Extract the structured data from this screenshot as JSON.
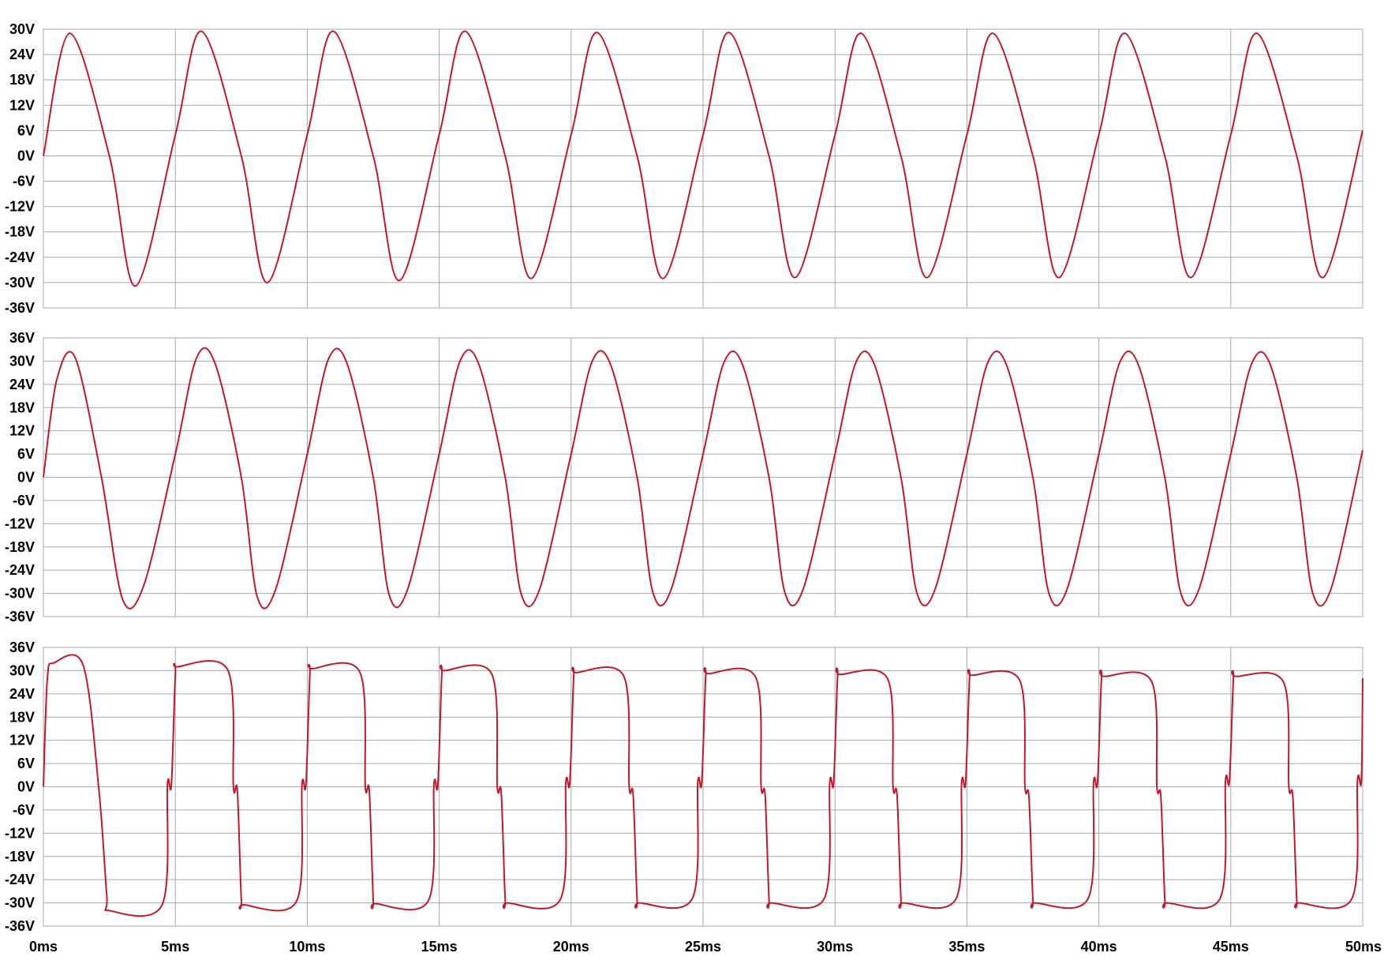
{
  "chart_data": [
    {
      "type": "line",
      "xlim": [
        0,
        50
      ],
      "ylim": [
        -36,
        30
      ],
      "yticks": [
        "30V",
        "24V",
        "18V",
        "12V",
        "6V",
        "0V",
        "-6V",
        "-12V",
        "-18V",
        "-24V",
        "-30V",
        "-36V"
      ],
      "grid": true,
      "series": [
        {
          "color": "#c0182c",
          "x": [
            0,
            1,
            2.5,
            3.5,
            5,
            6,
            7.5,
            8.5,
            10,
            11,
            12.5,
            13.5,
            15,
            16,
            17.5,
            18.5,
            20,
            21,
            22.5,
            23.5,
            25,
            26,
            27.5,
            28.5,
            30,
            31,
            32.5,
            33.5,
            35,
            36,
            37.5,
            38.5,
            40,
            41,
            42.5,
            43.5,
            45,
            46,
            47.5,
            48.5,
            50
          ],
          "y": [
            0,
            29,
            0,
            -30.8,
            5,
            29.5,
            0,
            -30,
            5,
            29.5,
            0,
            -29.5,
            5,
            29.5,
            0,
            -29,
            5,
            29.2,
            0,
            -29,
            5,
            29.2,
            0,
            -28.8,
            5,
            29,
            0,
            -28.8,
            5,
            29,
            0,
            -28.8,
            5,
            29,
            0,
            -28.8,
            5,
            29,
            0,
            -28.8,
            6
          ]
        }
      ]
    },
    {
      "type": "line",
      "xlim": [
        0,
        50
      ],
      "ylim": [
        -36,
        36
      ],
      "yticks": [
        "36V",
        "30V",
        "24V",
        "18V",
        "12V",
        "6V",
        "0V",
        "-6V",
        "-12V",
        "-18V",
        "-24V",
        "-30V",
        "-36V"
      ],
      "grid": true,
      "series": [
        {
          "color": "#c0182c",
          "x": [
            0,
            0.5,
            1.2,
            2.2,
            3,
            3.8,
            5,
            5.8,
            6.5,
            7.5,
            8.1,
            8.8,
            10,
            10.8,
            11.5,
            12.5,
            13.1,
            13.8,
            15,
            15.8,
            16.5,
            17.5,
            18.1,
            18.8,
            20,
            20.8,
            21.5,
            22.5,
            23.1,
            23.8,
            25,
            25.8,
            26.5,
            27.5,
            28.1,
            28.8,
            30,
            30.8,
            31.5,
            32.5,
            33.1,
            33.8,
            35,
            35.8,
            36.5,
            37.5,
            38.1,
            38.8,
            40,
            40.8,
            41.5,
            42.5,
            43.1,
            43.8,
            45,
            45.8,
            46.5,
            47.5,
            48.1,
            48.8,
            50
          ],
          "y": [
            0,
            25,
            31,
            0,
            -31.5,
            -28,
            6,
            30.8,
            29.5,
            0,
            -30.8,
            -29,
            6,
            30.5,
            29.5,
            0,
            -30.3,
            -29,
            6,
            30.2,
            29.2,
            0,
            -30,
            -29,
            6,
            30,
            29,
            0,
            -29.8,
            -28.8,
            6,
            29.8,
            29,
            0,
            -29.8,
            -28.8,
            6,
            29.8,
            29,
            0,
            -29.8,
            -28.8,
            6,
            29.8,
            29,
            0,
            -29.8,
            -28.8,
            6,
            29.8,
            29,
            0,
            -29.8,
            -28.8,
            6,
            29.5,
            29,
            0,
            -29.8,
            -28.8,
            7
          ]
        }
      ]
    },
    {
      "type": "line",
      "xlim": [
        0,
        50
      ],
      "ylim": [
        -36,
        36
      ],
      "yticks": [
        "36V",
        "30V",
        "24V",
        "18V",
        "12V",
        "6V",
        "0V",
        "-6V",
        "-12V",
        "-18V",
        "-24V",
        "-30V",
        "-36V"
      ],
      "grid": true,
      "series": [
        {
          "color": "#c0182c",
          "x": [
            0,
            0.15,
            0.4,
            1.5,
            2.1,
            2.4,
            2.5,
            4.5,
            4.7,
            4.85,
            5,
            5.1,
            7,
            7.2,
            7.35,
            7.5,
            7.6,
            9.6,
            9.8,
            9.95,
            10.1,
            10.2,
            12,
            12.2,
            12.35,
            12.5,
            12.6,
            14.6,
            14.8,
            14.95,
            15.1,
            15.2,
            17,
            17.2,
            17.35,
            17.5,
            17.6,
            19.6,
            19.8,
            19.95,
            20.1,
            20.2,
            22,
            22.2,
            22.35,
            22.5,
            22.6,
            24.6,
            24.8,
            24.95,
            25.1,
            25.2,
            27,
            27.2,
            27.35,
            27.5,
            27.6,
            29.6,
            29.8,
            29.95,
            30.1,
            30.2,
            32,
            32.2,
            32.35,
            32.5,
            32.6,
            34.6,
            34.8,
            34.95,
            35.1,
            35.2,
            37,
            37.2,
            37.35,
            37.5,
            37.6,
            39.6,
            39.8,
            39.95,
            40.1,
            40.2,
            42,
            42.2,
            42.35,
            42.5,
            42.6,
            44.6,
            44.8,
            44.95,
            45.1,
            45.2,
            47,
            47.2,
            47.35,
            47.5,
            47.6,
            49.6,
            49.8,
            49.95,
            50
          ],
          "y": [
            0,
            28,
            32,
            31.5,
            -0.5,
            -28,
            -32,
            -30.5,
            0.5,
            0.5,
            29,
            31,
            30,
            0,
            -1,
            -29,
            -30.5,
            -29.5,
            0.5,
            0.5,
            29,
            30.5,
            29.5,
            0,
            -1,
            -29,
            -30.2,
            -29.3,
            0.5,
            0.5,
            29,
            30,
            29,
            0,
            -1.5,
            -29,
            -30,
            -29,
            1,
            1,
            28.5,
            29.5,
            28.5,
            0,
            -2,
            -29,
            -30,
            -28.8,
            1,
            1,
            28.5,
            29.2,
            28.2,
            0,
            -2,
            -29,
            -30,
            -28.8,
            1,
            1,
            28.5,
            29,
            27.8,
            0,
            -2,
            -29,
            -30,
            -28.8,
            1,
            1,
            28,
            28.8,
            27.5,
            0,
            -2.5,
            -29,
            -30,
            -28.8,
            1,
            1,
            28,
            28.5,
            27.2,
            0,
            -2.5,
            -29,
            -30,
            -28.8,
            1.5,
            1.5,
            27.8,
            28.5,
            27,
            0,
            -2.5,
            -29,
            -30,
            -28.8,
            1.5,
            1.5,
            28
          ]
        }
      ]
    }
  ],
  "xticks": [
    "0ms",
    "5ms",
    "10ms",
    "15ms",
    "20ms",
    "25ms",
    "30ms",
    "35ms",
    "40ms",
    "45ms",
    "50ms"
  ]
}
